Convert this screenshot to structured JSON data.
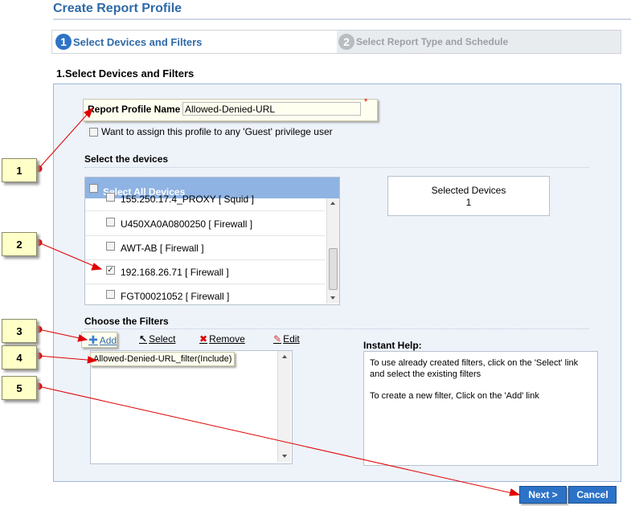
{
  "page_title": "Create Report Profile",
  "wizard": {
    "steps": [
      {
        "number": "1",
        "label": "Select Devices and Filters",
        "active": true
      },
      {
        "number": "2",
        "label": "Select Report Type and Schedule",
        "active": false
      }
    ]
  },
  "section_title": "1.Select Devices and Filters",
  "report_profile": {
    "label": "Report Profile Name",
    "value": "Allowed-Denied-URL",
    "required_mark": "*"
  },
  "guest_option": {
    "label": "Want to assign this profile to any 'Guest' privilege user",
    "checked": false
  },
  "devices": {
    "heading": "Select the devices",
    "select_all_label": "Select All Devices",
    "items": [
      {
        "label": "155.250.17.4_PROXY [ Squid ]",
        "checked": false
      },
      {
        "label": "U450XA0A0800250 [ Firewall ]",
        "checked": false
      },
      {
        "label": "AWT-AB [ Firewall ]",
        "checked": false
      },
      {
        "label": "192.168.26.71 [ Firewall ]",
        "checked": true
      },
      {
        "label": "FGT00021052 [ Firewall ]",
        "checked": false
      }
    ],
    "selected_box": {
      "title": "Selected Devices",
      "count": "1"
    }
  },
  "filters": {
    "heading": "Choose the Filters",
    "toolbar": {
      "add": "Add",
      "select": "Select",
      "remove": "Remove",
      "edit": "Edit"
    },
    "items": [
      "Allowed-Denied-URL_filter(Include)"
    ]
  },
  "instant_help": {
    "title": "Instant Help:",
    "line1": "To use already created filters, click on the 'Select' link and select the existing filters",
    "line2": "To create a new filter, Click on the 'Add' link"
  },
  "buttons": {
    "next": "Next >",
    "cancel": "Cancel"
  },
  "callouts": [
    "1",
    "2",
    "3",
    "4",
    "5"
  ],
  "colors": {
    "accent": "#2f6aa8",
    "button": "#2c73c8",
    "panel": "#eef3fa",
    "callout": "#ffffc8",
    "annotation_line": "#e00000"
  }
}
